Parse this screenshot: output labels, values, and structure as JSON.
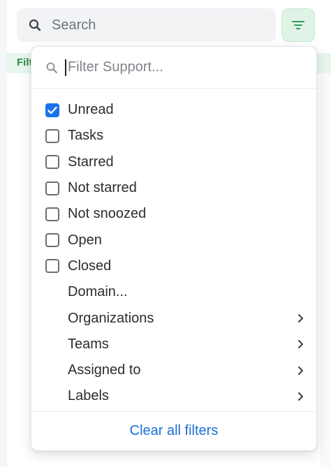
{
  "search": {
    "placeholder": "Search"
  },
  "filter_button": {
    "icon": "filter-icon"
  },
  "background": {
    "strip_label": "Filt"
  },
  "dropdown": {
    "search_placeholder": "Filter Support...",
    "checkbox_items": [
      {
        "label": "Unread",
        "checked": true
      },
      {
        "label": "Tasks",
        "checked": false
      },
      {
        "label": "Starred",
        "checked": false
      },
      {
        "label": "Not starred",
        "checked": false
      },
      {
        "label": "Not snoozed",
        "checked": false
      },
      {
        "label": "Open",
        "checked": false
      },
      {
        "label": "Closed",
        "checked": false
      }
    ],
    "menu_items": [
      {
        "label": "Domain...",
        "has_submenu": false
      },
      {
        "label": "Organizations",
        "has_submenu": true
      },
      {
        "label": "Teams",
        "has_submenu": true
      },
      {
        "label": "Assigned to",
        "has_submenu": true
      },
      {
        "label": "Labels",
        "has_submenu": true
      }
    ],
    "clear_label": "Clear all filters"
  },
  "colors": {
    "accent": "#1a73e8",
    "link": "#1a6fd4",
    "filter_button_bg": "#dff3e6",
    "filter_icon": "#2e9b58"
  }
}
